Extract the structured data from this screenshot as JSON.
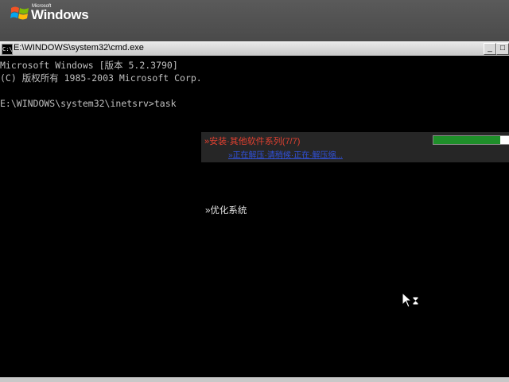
{
  "banner": {
    "ms_label": "Microsoft",
    "windows_label": "Windows"
  },
  "window": {
    "title": "E:\\WINDOWS\\system32\\cmd.exe",
    "icon_text": "C:\\",
    "min_label": "_",
    "max_label": "□"
  },
  "console": {
    "lines": [
      "Microsoft Windows [版本 5.2.3790]",
      "(C) 版权所有 1985-2003 Microsoft Corp.",
      "",
      "E:\\WINDOWS\\system32\\inetsrv>task"
    ]
  },
  "overlay": {
    "line1": "»安装·其他软件系列(7/7)",
    "line2": "»正在解压·请稍候·正在·解压缩...",
    "item": "»优化系统",
    "progress": 0.87,
    "progress_color": "#1f8f2a"
  },
  "icons": [
    "windows-flag-icon",
    "cmd-icon",
    "minimize-icon",
    "maximize-icon",
    "busy-cursor-icon"
  ]
}
